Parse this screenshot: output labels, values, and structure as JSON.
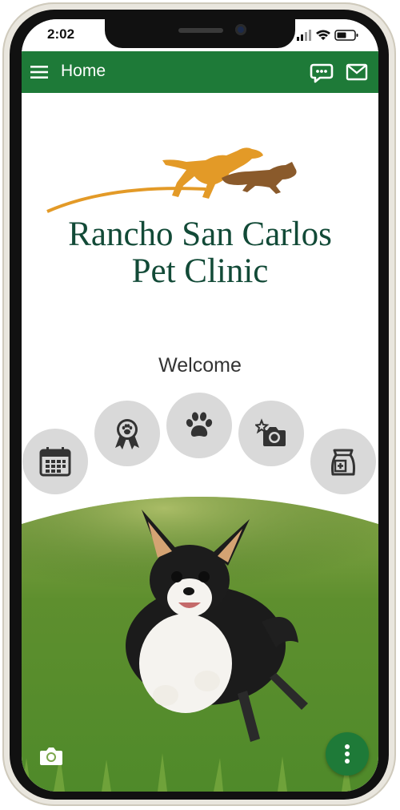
{
  "status_bar": {
    "time": "2:02"
  },
  "header": {
    "title": "Home",
    "menu_icon": "hamburger-menu-icon",
    "chat_icon": "chat-bubble-icon",
    "mail_icon": "envelope-icon"
  },
  "logo": {
    "line1": "Rancho San Carlos",
    "line2": "Pet Clinic",
    "graphic": "running-dog-and-cat-logo"
  },
  "welcome": "Welcome",
  "quick_actions": [
    {
      "icon": "calendar-icon"
    },
    {
      "icon": "award-ribbon-paw-icon"
    },
    {
      "icon": "paw-print-icon"
    },
    {
      "icon": "camera-star-icon"
    },
    {
      "icon": "pet-food-bag-icon"
    }
  ],
  "hero": {
    "image": "chihuahua-running-on-grass"
  },
  "footer": {
    "camera_icon": "camera-icon",
    "more_icon": "more-vertical-icon"
  },
  "colors": {
    "brand_green": "#1e7a38",
    "logo_green": "#124a37",
    "logo_orange": "#e39a27",
    "logo_brown": "#8a5a2b",
    "button_gray": "#d9d9d9"
  }
}
